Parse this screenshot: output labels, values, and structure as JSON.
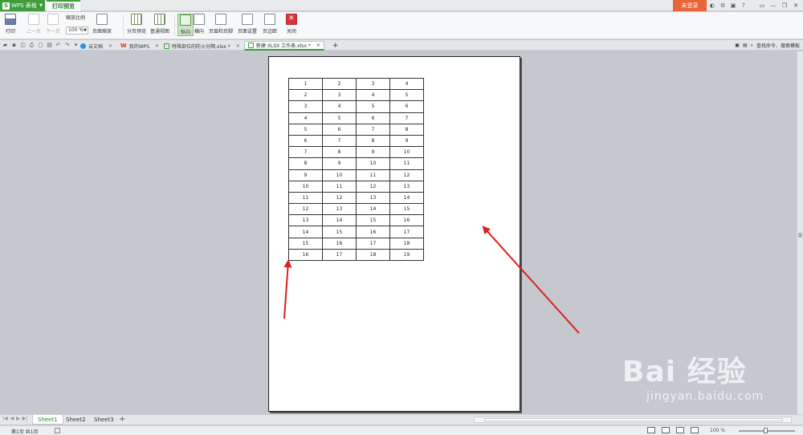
{
  "titlebar": {
    "app_name": "WPS 表格",
    "mode_tab": "打印预览",
    "login": "未登录"
  },
  "ribbon": {
    "print": "打印",
    "prev_page": "上一页",
    "next_page": "下一页",
    "zoom_ratio_label": "缩放比例",
    "zoom_value": "100 %",
    "page_zoom": "页面缩放",
    "page_break_preview": "分页预览",
    "normal_view": "普通视图",
    "portrait": "纵向",
    "landscape": "横向",
    "header_footer": "页眉和页脚",
    "page_setup": "页面设置",
    "margins": "页边距",
    "close": "关闭"
  },
  "tabs": {
    "cloud_docs": "云文档",
    "my_wps": "我的WPS",
    "file1": "特殊部位的防火分隔.xlsx *",
    "file2": "新建 XLSX 工作表.xlsx *",
    "search": "查找命令、搜索模板"
  },
  "table_rows": [
    [
      "1",
      "2",
      "3",
      "4"
    ],
    [
      "2",
      "3",
      "4",
      "5"
    ],
    [
      "3",
      "4",
      "5",
      "6"
    ],
    [
      "4",
      "5",
      "6",
      "7"
    ],
    [
      "5",
      "6",
      "7",
      "8"
    ],
    [
      "6",
      "7",
      "8",
      "9"
    ],
    [
      "7",
      "8",
      "9",
      "10"
    ],
    [
      "8",
      "9",
      "10",
      "11"
    ],
    [
      "9",
      "10",
      "11",
      "12"
    ],
    [
      "10",
      "11",
      "12",
      "13"
    ],
    [
      "11",
      "12",
      "13",
      "14"
    ],
    [
      "12",
      "13",
      "14",
      "15"
    ],
    [
      "13",
      "14",
      "15",
      "16"
    ],
    [
      "14",
      "15",
      "16",
      "17"
    ],
    [
      "15",
      "16",
      "17",
      "18"
    ],
    [
      "16",
      "17",
      "18",
      "19"
    ]
  ],
  "sheets": [
    "Sheet1",
    "Sheet2",
    "Sheet3"
  ],
  "status": {
    "page_info": "第1页 共1页",
    "zoom": "100 %"
  },
  "watermark": {
    "brand": "Bai  经验",
    "site": "jingyan.baidu.com"
  },
  "colors": {
    "wps_green": "#3f9d3c",
    "login_orange": "#e9653a",
    "arrow_red": "#e0201c"
  }
}
